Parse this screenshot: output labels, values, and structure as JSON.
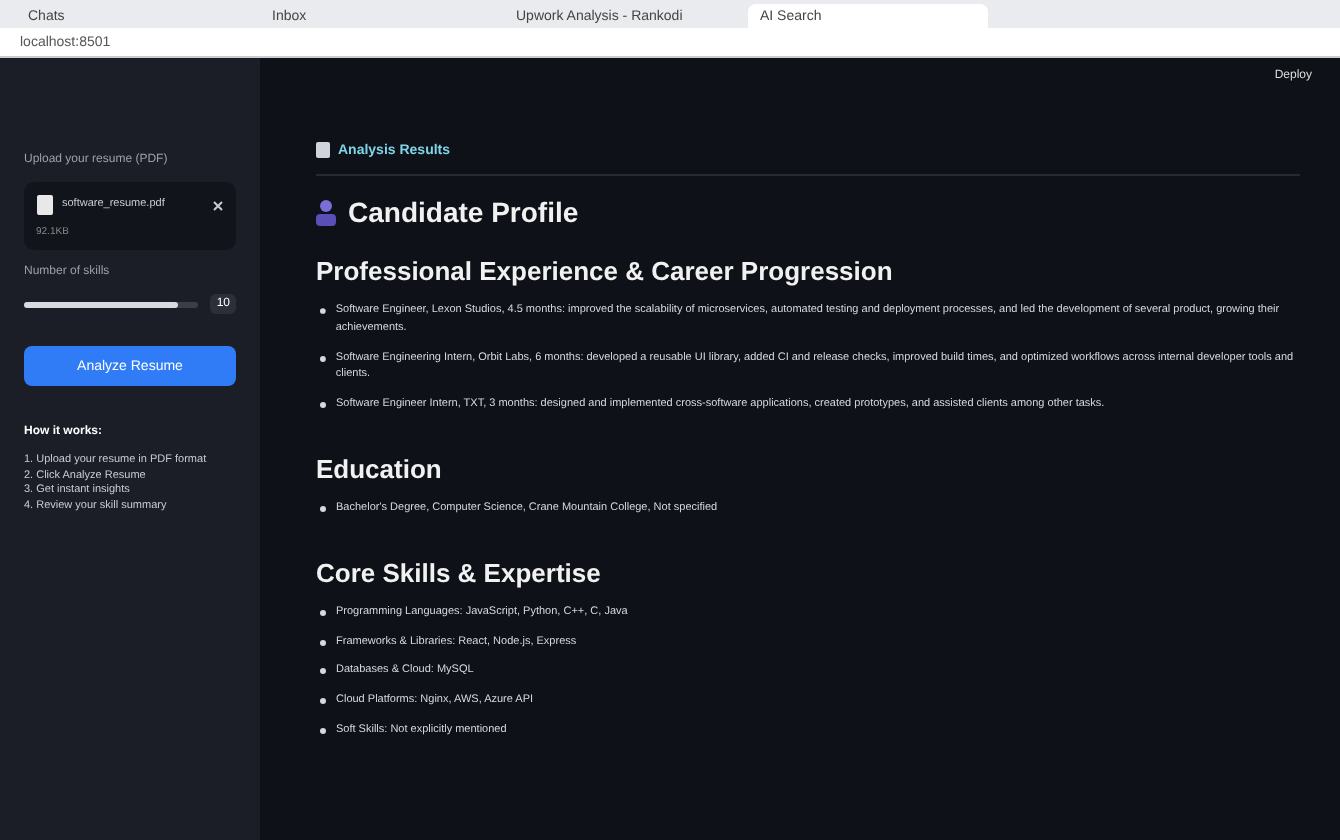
{
  "browser": {
    "tabs": [
      {
        "label": "Chats",
        "selected": false
      },
      {
        "label": "Inbox",
        "selected": false
      },
      {
        "label": "Upwork Analysis - Rankodi",
        "selected": false
      },
      {
        "label": "AI Search",
        "selected": true
      }
    ],
    "url": "localhost:8501"
  },
  "sidebar": {
    "upload_label": "Upload your resume (PDF)",
    "file": {
      "name": "software_resume.pdf",
      "size": "92.1KB"
    },
    "slider": {
      "label": "Number of skills",
      "level": 0.88,
      "reading": "10"
    },
    "button": "Analyze Resume",
    "help_title": "How it works:",
    "help_items": [
      "1. Upload your resume in PDF format",
      "2. Click Analyze Resume",
      "3. Get instant insights",
      "4. Review your skill summary"
    ]
  },
  "header": {
    "deploy": "Deploy"
  },
  "main": {
    "results_label": "Analysis Results",
    "profile_title": "Candidate Profile",
    "sections": [
      {
        "title": "Professional Experience & Career Progression",
        "items": [
          "Software Engineer, Lexon Studios, 4.5 months: improved the scalability of microservices, automated testing and deployment processes, and led the development of several product, growing their achievements.",
          "Software Engineering Intern, Orbit Labs, 6 months: developed a reusable UI library, added CI and release checks, improved build times, and optimized workflows across internal developer tools and clients.",
          "Software Engineer Intern, TXT, 3 months: designed and implemented cross-software applications, created prototypes, and assisted clients among other tasks."
        ]
      },
      {
        "title": "Education",
        "items": [
          "Bachelor's Degree, Computer Science, Crane Mountain College, Not specified"
        ]
      },
      {
        "title": "Core Skills & Expertise",
        "items": [
          "Programming Languages: JavaScript, Python, C++, C, Java",
          "Frameworks & Libraries: React, Node.js, Express",
          "Databases & Cloud: MySQL",
          "Cloud Platforms: Nginx, AWS, Azure API",
          "Soft Skills: Not explicitly mentioned"
        ]
      }
    ]
  }
}
